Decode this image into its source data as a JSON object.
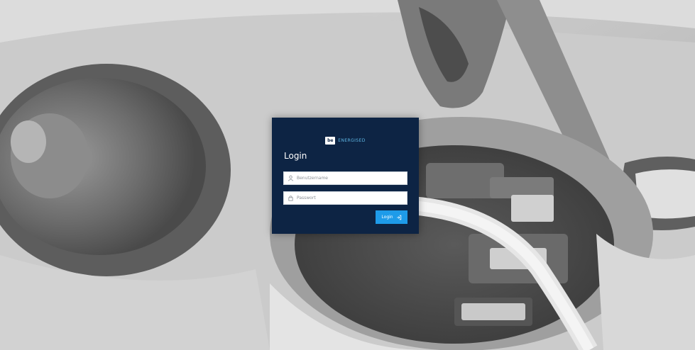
{
  "brand": {
    "badge": "be",
    "name": "ENERGISED"
  },
  "login": {
    "title": "Login",
    "username": {
      "placeholder": "Benutzername",
      "value": "",
      "icon": "user-icon"
    },
    "password": {
      "placeholder": "Passwort",
      "value": "",
      "icon": "lock-icon"
    },
    "submit_label": "Login",
    "submit_icon": "sign-in-arrow-icon"
  },
  "colors": {
    "card": "#0d2444",
    "accent": "#1e9be9",
    "brand_text": "#5fb8e6"
  }
}
